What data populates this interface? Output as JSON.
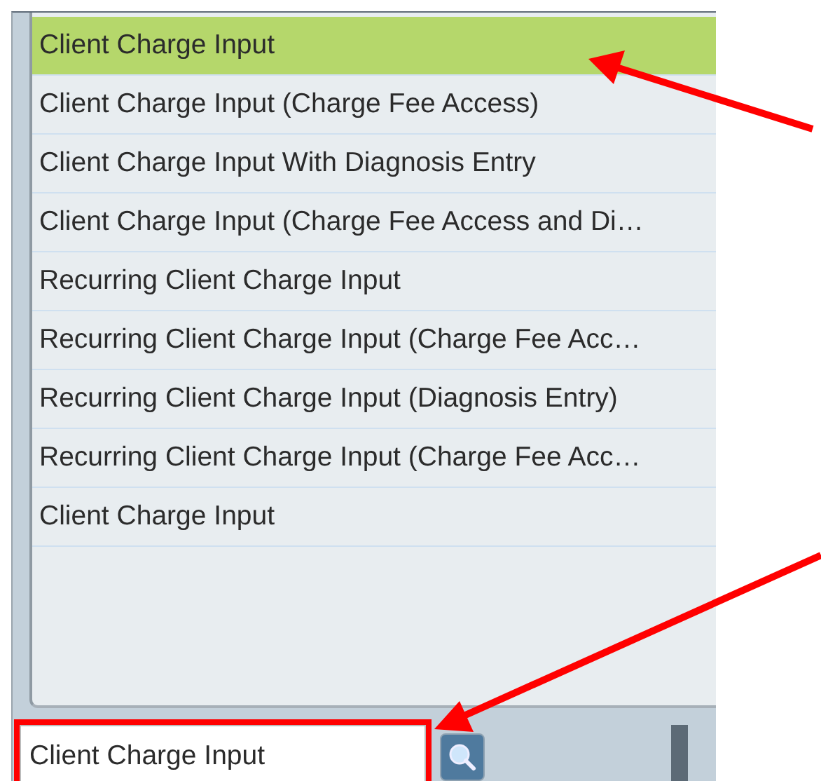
{
  "list": {
    "items": [
      {
        "label": "Client Charge Input",
        "selected": true
      },
      {
        "label": "Client Charge Input (Charge Fee Access)",
        "selected": false
      },
      {
        "label": "Client Charge Input With Diagnosis Entry",
        "selected": false
      },
      {
        "label": "Client Charge Input (Charge Fee Access and Di…",
        "selected": false
      },
      {
        "label": "Recurring Client Charge Input",
        "selected": false
      },
      {
        "label": "Recurring Client Charge Input (Charge Fee Acc…",
        "selected": false
      },
      {
        "label": "Recurring Client Charge Input (Diagnosis Entry)",
        "selected": false
      },
      {
        "label": "Recurring Client Charge Input (Charge Fee Acc…",
        "selected": false
      },
      {
        "label": "Client Charge Input",
        "selected": false
      }
    ]
  },
  "search": {
    "value": "Client Charge Input"
  }
}
